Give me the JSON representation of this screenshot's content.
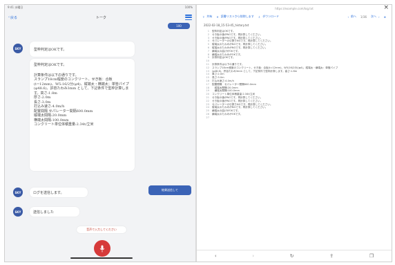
{
  "left": {
    "status": {
      "left": "9:41 水曜日",
      "right": "100%"
    },
    "header": {
      "back": "戻る",
      "title": "トーク"
    },
    "top_chip": "100",
    "avatar_label": "SKY",
    "messages": [
      {
        "id": "m1",
        "text": "型枠判定はOKです。"
      },
      {
        "id": "m2",
        "head": "型枠判定はOKです。",
        "body": "計算条件は以下の通りです。\nスランプ18cm程度のコンクリート、せき板：合板(t=12mm)、W5:16/2分(φ4)、縦端太・横端太：単管パイプ(φ48.6)、許容たわみ3mm として、下記条件で型枠計算します。高さ:1.8m\n厚さ:2.0m\n長さ:3.0m\n打込み速さ:4.0m/h\n配置間隔 セパレーター間隔600.0mm\n縦端太間隔:20.0mm\n横端太間隔:100.0mm\nコンクリート単位体積重量:2.34t/立米"
      },
      {
        "id": "m3",
        "text": "ログを送信します。"
      },
      {
        "id": "m4",
        "text": "送信しました"
      }
    ],
    "send_result_btn": "結果送信して",
    "voice_hint": "音声で入力してください"
  },
  "right": {
    "url": "https://example.com/log.txt",
    "toolbar": {
      "share": "共有",
      "reading_list": "読書リストから削除します",
      "download": "ダウンロード",
      "prev": "前へ",
      "count": "1/36",
      "next": "次へ"
    },
    "filename": "2022-02-18_15-53-45_history.txt",
    "lines": [
      {
        "n": "1",
        "t": "型枠判定はOKです。"
      },
      {
        "n": "2",
        "t": "せき板の値がNGです。再計算してください。"
      },
      {
        "n": "3",
        "t": "せき板の値がNGです。再計算してください。"
      },
      {
        "n": "4",
        "t": "セパレーターの引張りNGです。再計算してください。"
      },
      {
        "n": "5",
        "t": "縦端太のたわみがNGです。再計算してください。"
      },
      {
        "n": "6",
        "t": "縦端太のたわみがNGです。再計算してください。"
      },
      {
        "n": "7",
        "t": "横端太の曲げがOKです。"
      },
      {
        "n": "8",
        "t": "横端太のたわみがOKです。"
      },
      {
        "n": "9",
        "t": "計算判定はOKです。"
      },
      {
        "n": "10",
        "t": ""
      },
      {
        "n": "11",
        "t": "計算条件は以下の通りです。"
      },
      {
        "n": "12",
        "t": "スランプ18cm程度のコンクリート、せき板：合板(t=12mm)、W5/16(2分)(φ4)、縦端太・横端太：単管パイプ"
      },
      {
        "n": "13",
        "t": "(φ48.6)、許容たわみ3mm として、下記条件で型枠計算します。高さ:1.8m"
      },
      {
        "n": "14",
        "t": "厚さ:2.0m"
      },
      {
        "n": "15",
        "t": "長さ:3.0m"
      },
      {
        "n": "16",
        "t": "打込み速さ:4.0m/h"
      },
      {
        "n": "17",
        "t": "配置間隔　セパレーター間隔600.0mm"
      },
      {
        "n": "18",
        "t": "　縦端太間隔:20.0mm"
      },
      {
        "n": "19",
        "t": "　横端太間隔:100.0mm"
      },
      {
        "n": "20",
        "t": "コンクリート単位体積重量:2.34t/立米"
      },
      {
        "n": "21",
        "t": "せき板の値がNGです。再計算してください。"
      },
      {
        "n": "22",
        "t": "せき板の値がNGです。再計算してください。"
      },
      {
        "n": "23",
        "t": "セパレーターの引張りNGです。再計算してください。"
      },
      {
        "n": "24",
        "t": "縦端太のたわみがNGです。再計算してください。"
      },
      {
        "n": "25",
        "t": "横端太の曲げがOKです。"
      },
      {
        "n": "26",
        "t": "横端太のたわみがOKです。"
      },
      {
        "n": "27",
        "t": ""
      }
    ]
  }
}
